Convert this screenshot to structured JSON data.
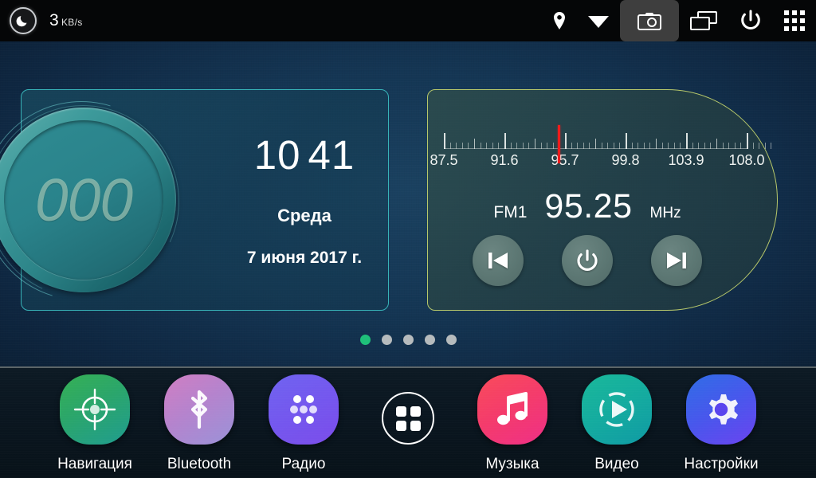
{
  "statusbar": {
    "moon_icon": "moon-icon",
    "network_speed_value": "3",
    "network_speed_unit": "KB/s",
    "icons": [
      {
        "name": "location-icon",
        "label": "Location"
      },
      {
        "name": "wifi-icon",
        "label": "Wi-Fi"
      },
      {
        "name": "camera-icon",
        "label": "Camera",
        "highlighted": true
      },
      {
        "name": "recent-apps-icon",
        "label": "Recent apps"
      },
      {
        "name": "power-icon",
        "label": "Power"
      },
      {
        "name": "app-grid-icon",
        "label": "Apps"
      }
    ]
  },
  "clock_widget": {
    "dial_value": "000",
    "time_hours": "10",
    "time_minutes": "41",
    "weekday": "Среда",
    "date": "7 июня 2017 г.",
    "border_color": "#37b3b8"
  },
  "radio_widget": {
    "band": "FM1",
    "frequency": "95.25",
    "unit": "MHz",
    "marker_frequency": 95.25,
    "border_color": "#b7c86a",
    "marker_color": "#ee1c1c",
    "scale": {
      "min": 87.5,
      "max": 108.0,
      "labels": [
        "87.5",
        "91.6",
        "95.7",
        "99.8",
        "103.9",
        "108.0"
      ]
    },
    "buttons": [
      {
        "name": "radio-prev-button",
        "icon": "skip-previous-icon"
      },
      {
        "name": "radio-power-button",
        "icon": "power-icon"
      },
      {
        "name": "radio-next-button",
        "icon": "skip-next-icon"
      }
    ]
  },
  "page_indicator": {
    "total": 5,
    "active_index": 0,
    "active_color": "#1fc07a",
    "inactive_color": "#b6bbbd"
  },
  "dock": {
    "apps": [
      {
        "label": "Навигация",
        "icon": "navigation-crosshair-icon",
        "style": "nav"
      },
      {
        "label": "Bluetooth",
        "icon": "bluetooth-icon",
        "style": "bt"
      },
      {
        "label": "Радио",
        "icon": "radio-dots-icon",
        "style": "radio"
      }
    ],
    "drawer": {
      "name": "app-drawer-button",
      "icon": "app-drawer-icon"
    },
    "apps_right": [
      {
        "label": "Музыка",
        "icon": "music-note-icon",
        "style": "music"
      },
      {
        "label": "Видео",
        "icon": "video-play-icon",
        "style": "video"
      },
      {
        "label": "Настройки",
        "icon": "settings-gear-icon",
        "style": "settings"
      }
    ]
  }
}
